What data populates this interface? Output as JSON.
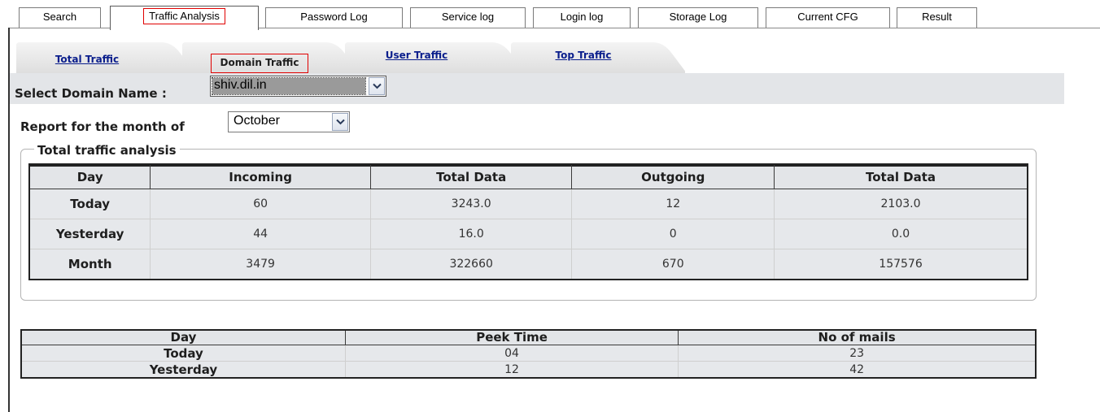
{
  "top_tabs": [
    {
      "label": "Search",
      "active": false
    },
    {
      "label": "Traffic Analysis",
      "active": true
    },
    {
      "label": "Password Log",
      "active": false
    },
    {
      "label": "Service log",
      "active": false
    },
    {
      "label": "Login log",
      "active": false
    },
    {
      "label": "Storage Log",
      "active": false
    },
    {
      "label": "Current CFG",
      "active": false
    },
    {
      "label": "Result",
      "active": false
    }
  ],
  "sub_tabs": [
    {
      "label": "Total Traffic"
    },
    {
      "label": "Domain Traffic",
      "active": true
    },
    {
      "label": "User Traffic"
    },
    {
      "label": "Top Traffic"
    }
  ],
  "domain_select": {
    "label": "Select Domain Name :",
    "value": "shiv.dil.in"
  },
  "month_select": {
    "label": "Report for the month of",
    "value": "October"
  },
  "traffic": {
    "legend": "Total traffic analysis",
    "headers": [
      "Day",
      "Incoming",
      "Total Data",
      "Outgoing",
      "Total Data"
    ],
    "rows": [
      [
        "Today",
        "60",
        "3243.0",
        "12",
        "2103.0"
      ],
      [
        "Yesterday",
        "44",
        "16.0",
        "0",
        "0.0"
      ],
      [
        "Month",
        "3479",
        "322660",
        "670",
        "157576"
      ]
    ]
  },
  "peak": {
    "headers": [
      "Day",
      "Peek Time",
      "No of mails"
    ],
    "rows": [
      [
        "Today",
        "04",
        "23"
      ],
      [
        "Yesterday",
        "12",
        "42"
      ]
    ]
  },
  "colors": {
    "accent_link": "#0a1e8c",
    "highlight_box": "#e00000",
    "table_bg": "#e6e8eb"
  }
}
